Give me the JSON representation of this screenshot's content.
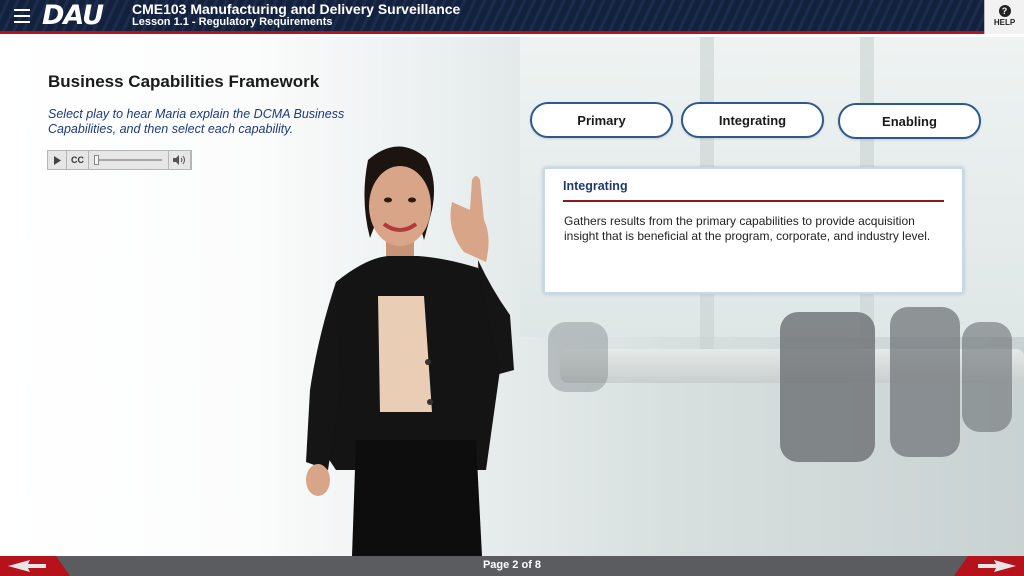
{
  "header": {
    "logo": "DAU",
    "course_title": "CME103 Manufacturing and Delivery Surveillance",
    "lesson_title": "Lesson 1.1 - Regulatory Requirements",
    "help_label": "HELP",
    "help_icon_glyph": "?",
    "brand_color": "#14213d",
    "accent_color": "#b5121b"
  },
  "content": {
    "heading": "Business Capabilities Framework",
    "instructions": "Select play to hear Maria explain the DCMA Business Capabilities, and then select each capability.",
    "player": {
      "play_icon": "play-icon",
      "cc_label": "CC",
      "volume_icon": "volume-icon",
      "progress": 0
    },
    "capabilities": [
      {
        "label": "Primary"
      },
      {
        "label": "Integrating"
      },
      {
        "label": "Enabling"
      }
    ],
    "panel": {
      "title": "Integrating",
      "body": "Gathers results from the primary capabilities to provide acquisition insight that is beneficial at the program, corporate, and industry level."
    }
  },
  "footer": {
    "page_indicator": "Page 2 of 8",
    "prev_icon": "back-arrow-icon",
    "next_icon": "next-arrow-icon"
  }
}
